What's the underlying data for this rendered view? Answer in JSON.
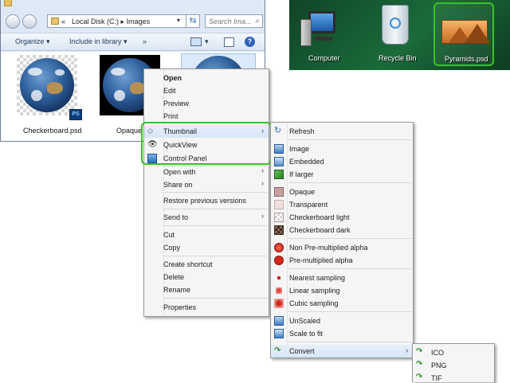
{
  "explorer": {
    "address": {
      "prefix": "«",
      "path1": "Local Disk (C:)",
      "sep": "▸",
      "path2": "Images",
      "dropdown": "▾"
    },
    "refresh_glyph": "⇆",
    "search_placeholder": "Search Ima...",
    "search_glyph": "⌕",
    "toolbar": {
      "organize": "Organize ▾",
      "include": "Include in library ▾",
      "more": "»",
      "views": "▾",
      "help": "?"
    },
    "files": [
      {
        "label": "Checkerboard.psd",
        "badge": "PS"
      },
      {
        "label": "Opaque"
      }
    ]
  },
  "desktop": {
    "icons": [
      {
        "label": "Computer"
      },
      {
        "label": "Recycle Bin"
      },
      {
        "label": "Pyramids.psd"
      }
    ]
  },
  "context_menu": {
    "items": [
      {
        "label": "Open"
      },
      {
        "label": "Edit"
      },
      {
        "label": "Preview"
      },
      {
        "label": "Print"
      },
      {
        "label": "Thumbnail",
        "arrow": "›"
      },
      {
        "label": "QuickView"
      },
      {
        "label": "Control Panel"
      },
      {
        "label": "Open with",
        "arrow": "›"
      },
      {
        "label": "Share on",
        "arrow": "›"
      },
      {
        "label": "Restore previous versions"
      },
      {
        "label": "Send to",
        "arrow": "›"
      },
      {
        "label": "Cut"
      },
      {
        "label": "Copy"
      },
      {
        "label": "Create shortcut"
      },
      {
        "label": "Delete"
      },
      {
        "label": "Rename"
      },
      {
        "label": "Properties"
      }
    ]
  },
  "thumbnail_submenu": {
    "items": [
      {
        "label": "Refresh"
      },
      {
        "label": "Image"
      },
      {
        "label": "Embedded"
      },
      {
        "label": "If larger"
      },
      {
        "label": "Opaque"
      },
      {
        "label": "Transparent"
      },
      {
        "label": "Checkerboard light"
      },
      {
        "label": "Checkerboard dark"
      },
      {
        "label": "Non Pre-multiplied alpha"
      },
      {
        "label": "Pre-multiplied alpha"
      },
      {
        "label": "Nearest sampling"
      },
      {
        "label": "Linear sampling"
      },
      {
        "label": "Cubic sampling"
      },
      {
        "label": "UnScaled"
      },
      {
        "label": "Scale to fit"
      },
      {
        "label": "Convert",
        "arrow": "›"
      }
    ]
  },
  "convert_submenu": {
    "items": [
      {
        "label": "ICO"
      },
      {
        "label": "PNG"
      },
      {
        "label": "TIF"
      }
    ]
  },
  "colors": {
    "highlight": "#3bc126",
    "menu_bg": "#f5f5f5",
    "desktop": "#1b6b3a"
  }
}
